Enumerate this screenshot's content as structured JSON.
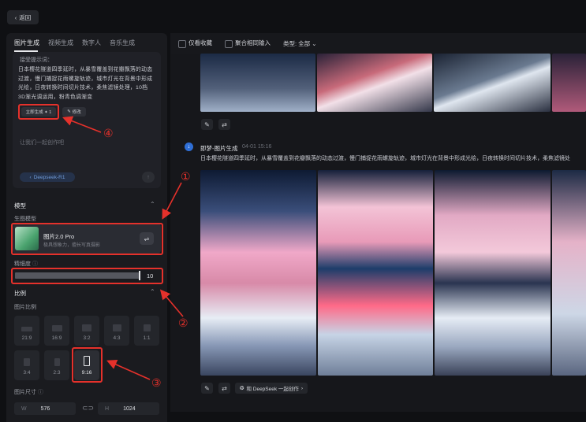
{
  "back_label": "返回",
  "left_panel": {
    "tabs": [
      {
        "label": "图片生成",
        "active": true
      },
      {
        "label": "视频生成",
        "active": false
      },
      {
        "label": "数字人",
        "active": false
      },
      {
        "label": "音乐生成",
        "active": false
      }
    ],
    "prompt": {
      "label": "接受提示词：",
      "text": "日本樱花隧道四季延时，从暴雪覆盖到花瓣飘落的动态过渡，慢门捕捉花雨螺旋轨迹，城市灯光在背景中形成光绘，日夜转换时间切片技术，柔焦滤镜处理，10档3D渐光调运用，粉青色调渐变",
      "generate_label": "立即生成 ✦ 1",
      "modify_label": "修改"
    },
    "chat_placeholder": "让我们一起创作吧",
    "chat_model": "Deepseek-R1",
    "model_section": {
      "title": "模型",
      "subtitle": "生图模型",
      "model_name": "图片2.0 Pro",
      "model_desc": "极具想象力，擅长写真摄影"
    },
    "detail": {
      "label": "精细度",
      "value": "10",
      "level": 1.0
    },
    "ratio_section": {
      "title": "比例",
      "subtitle": "图片比例",
      "options": [
        "21:9",
        "16:9",
        "3:2",
        "4:3",
        "1:1",
        "3:4",
        "2:3",
        "9:16"
      ],
      "selected": "9:16"
    },
    "size": {
      "label": "图片尺寸",
      "w_label": "W",
      "w": "576",
      "h_label": "H",
      "h": "1024"
    }
  },
  "toolbar": {
    "only_favorites": "仅看收藏",
    "aggregate_same_input": "聚合相同输入",
    "type_label": "类型: 全部"
  },
  "record": {
    "source": "即梦-图片生成",
    "timestamp": "04-01  15:16",
    "prompt": "日本樱花隧道四季延时，从暴雪覆盖到花瓣飘落的动态过渡，慢门捕捉花雨螺旋轨迹，城市灯光在背景中形成光绘，日夜转换时间切片技术，柔焦滤镜处"
  },
  "deepseek_button": "和 DeepSeek 一起创作",
  "annotations": [
    "①",
    "②",
    "③",
    "④"
  ],
  "colors": {
    "accent_red": "#e5312b",
    "panel_bg": "#1a1b1f",
    "page_bg": "#0f1013"
  }
}
